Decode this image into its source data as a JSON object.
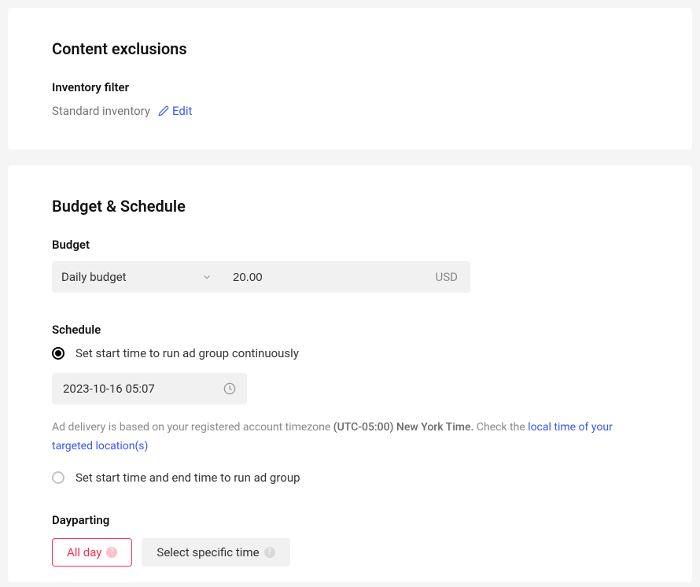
{
  "content_exclusions": {
    "title": "Content exclusions",
    "inventory_filter_label": "Inventory filter",
    "inventory_value": "Standard inventory",
    "edit_label": "Edit"
  },
  "budget_schedule": {
    "title": "Budget & Schedule",
    "budget_label": "Budget",
    "budget_type": "Daily budget",
    "budget_amount": "20.00",
    "budget_currency": "USD",
    "schedule_label": "Schedule",
    "radio_continuous": "Set start time to run ad group continuously",
    "start_datetime": "2023-10-16 05:07",
    "help_prefix": "Ad delivery is based on your registered account timezone ",
    "help_timezone": "(UTC-05:00) New York Time.",
    "help_check": " Check the ",
    "help_link": "local time of your targeted location(s)",
    "radio_endtime": "Set start time and end time to run ad group",
    "dayparting_label": "Dayparting",
    "toggle_allday": "All day",
    "toggle_specific": "Select specific time"
  }
}
